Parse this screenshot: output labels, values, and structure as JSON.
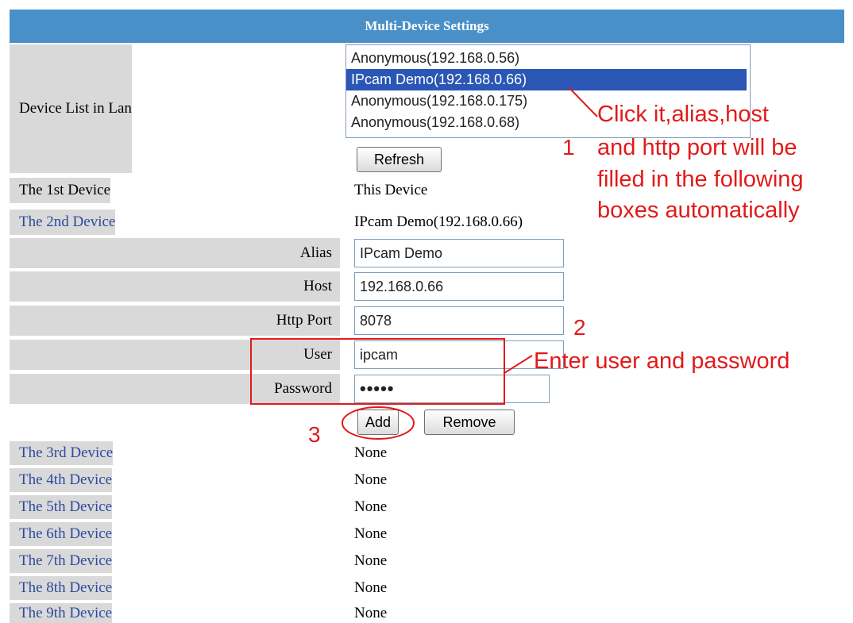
{
  "header": {
    "title": "Multi-Device Settings"
  },
  "device_list": {
    "label": "Device List in Lan",
    "options": [
      "Anonymous(192.168.0.56)",
      "IPcam Demo(192.168.0.66)",
      "Anonymous(192.168.0.175)",
      "Anonymous(192.168.0.68)"
    ],
    "selected_index": 1,
    "refresh_label": "Refresh"
  },
  "first_device": {
    "label": "The 1st Device",
    "value": "This Device"
  },
  "second_device": {
    "label": "The 2nd Device",
    "value": "IPcam Demo(192.168.0.66)"
  },
  "form": {
    "alias_label": "Alias",
    "alias_value": "IPcam Demo",
    "host_label": "Host",
    "host_value": "192.168.0.66",
    "port_label": "Http Port",
    "port_value": "8078",
    "user_label": "User",
    "user_value": "ipcam",
    "password_label": "Password",
    "password_value": "•••••",
    "add_label": "Add",
    "remove_label": "Remove"
  },
  "devices": [
    {
      "label": "The 3rd Device",
      "value": "None"
    },
    {
      "label": "The 4th Device",
      "value": "None"
    },
    {
      "label": "The 5th Device",
      "value": "None"
    },
    {
      "label": "The 6th Device",
      "value": "None"
    },
    {
      "label": "The 7th Device",
      "value": "None"
    },
    {
      "label": "The 8th Device",
      "value": "None"
    },
    {
      "label": "The 9th Device",
      "value": "None"
    }
  ],
  "annotations": {
    "step1_number": "1",
    "step1_text": "Click it,alias,host and http port will be filled in the following boxes automatically",
    "step1_lines": [
      "Click it,alias,host",
      "and http port will be",
      "filled in the following",
      "boxes automatically"
    ],
    "step2_number": "2",
    "step2_text": "Enter user and password",
    "step3_number": "3",
    "color": "#e21a1a"
  },
  "colors": {
    "header_bg": "#4a90c8",
    "label_bg": "#d9d9d9",
    "link_text": "#2e4a9e",
    "selection": "#2a56b5"
  }
}
